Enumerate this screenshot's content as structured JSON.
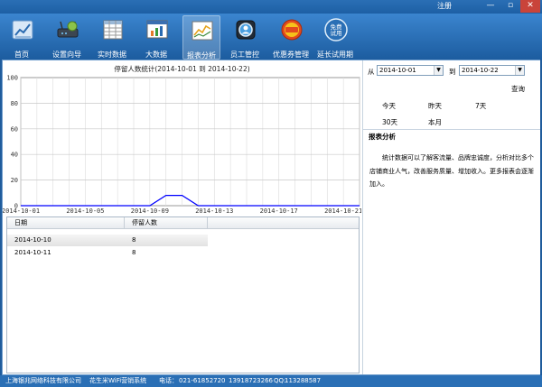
{
  "window": {
    "register_label": "注册",
    "minimize_glyph": "—",
    "restore_glyph": "▫",
    "close_glyph": "✕"
  },
  "toolbar": {
    "items": [
      {
        "label": "首页",
        "icon": "home-chart-icon"
      },
      {
        "label": "设置向导",
        "icon": "router-wizard-icon"
      },
      {
        "label": "实时数据",
        "icon": "spreadsheet-icon"
      },
      {
        "label": "大数据",
        "icon": "chart-window-icon"
      },
      {
        "label": "报表分析",
        "icon": "report-analysis-icon",
        "active": true
      },
      {
        "label": "员工管控",
        "icon": "staff-control-icon"
      },
      {
        "label": "优惠券管理",
        "icon": "coupon-icon"
      },
      {
        "label": "延长试用期",
        "icon": "free-trial-icon",
        "icon_text": "免费试用"
      }
    ]
  },
  "chart_data": {
    "type": "line",
    "title": "停留人数统计(2014-10-01 到 2014-10-22)",
    "x_start": "2014-10-01",
    "x_end": "2014-10-22",
    "x_ticks": [
      "2014-10-01",
      "2014-10-05",
      "2014-10-09",
      "2014-10-13",
      "2014-10-17",
      "2014-10-21"
    ],
    "ylim": [
      0,
      100
    ],
    "y_ticks": [
      0,
      20,
      40,
      60,
      80,
      100
    ],
    "grid": true,
    "series_color": "#0000ff",
    "points": [
      {
        "x": "2014-10-01",
        "y": 0
      },
      {
        "x": "2014-10-09",
        "y": 0
      },
      {
        "x": "2014-10-10",
        "y": 8
      },
      {
        "x": "2014-10-11",
        "y": 8
      },
      {
        "x": "2014-10-12",
        "y": 0
      },
      {
        "x": "2014-10-22",
        "y": 0
      }
    ]
  },
  "grid": {
    "columns": [
      "日期",
      "停留人数",
      ""
    ],
    "rows": [
      [
        "2014-10-10",
        "8"
      ],
      [
        "2014-10-11",
        "8"
      ]
    ]
  },
  "filter": {
    "from_label": "从",
    "from_value": "2014-10-01",
    "to_label": "到",
    "to_value": "2014-10-22",
    "query_label": "查询",
    "quick": [
      "今天",
      "昨天",
      "7天",
      "30天",
      "本月"
    ]
  },
  "analysis": {
    "heading": "报表分析",
    "text": "统计数据可以了解客流量、品牌忠诚度，分析对比多个店铺商业人气，改善服务质量、增加收入。更多报表会逐渐加入。"
  },
  "status": {
    "company": "上海银兆网络科技有限公司",
    "product": "花生米WiFi营销系统",
    "phone_label": "电话：",
    "phone": "021-61852720",
    "mobile": "13918723266",
    "qq_label": "QQ:",
    "qq": "113288587"
  }
}
